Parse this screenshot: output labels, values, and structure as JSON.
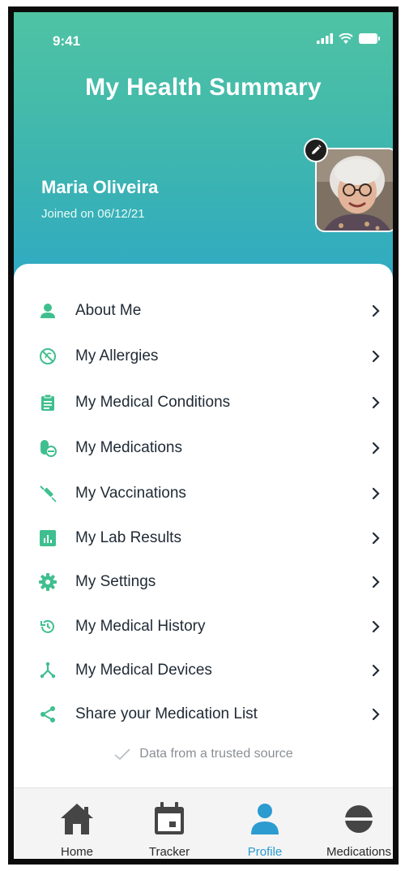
{
  "status_bar": {
    "time": "9:41"
  },
  "header": {
    "title": "My Health Summary",
    "user_name": "Maria Oliveira",
    "joined": "Joined on 06/12/21"
  },
  "colors": {
    "accent_green": "#3fbf8f",
    "accent_blue": "#2b9bd0",
    "text_dark": "#1f2a35"
  },
  "menu": {
    "items": [
      {
        "label": "About Me",
        "icon": "person-icon"
      },
      {
        "label": "My Allergies",
        "icon": "allergy-icon"
      },
      {
        "label": "My Medical Conditions",
        "icon": "clipboard-icon"
      },
      {
        "label": "My Medications",
        "icon": "pill-icon"
      },
      {
        "label": "My Vaccinations",
        "icon": "syringe-icon"
      },
      {
        "label": "My Lab Results",
        "icon": "chart-icon"
      },
      {
        "label": "My Settings",
        "icon": "gear-icon"
      },
      {
        "label": "My Medical History",
        "icon": "history-icon"
      },
      {
        "label": "My Medical Devices",
        "icon": "device-icon"
      },
      {
        "label": "Share your Medication List",
        "icon": "share-icon"
      }
    ]
  },
  "trusted": {
    "text": "Data from a trusted source"
  },
  "tabs": [
    {
      "label": "Home",
      "icon": "home-icon",
      "active": false
    },
    {
      "label": "Tracker",
      "icon": "calendar-icon",
      "active": false
    },
    {
      "label": "Profile",
      "icon": "profile-icon",
      "active": true
    },
    {
      "label": "Medications",
      "icon": "capsule-icon",
      "active": false
    }
  ]
}
